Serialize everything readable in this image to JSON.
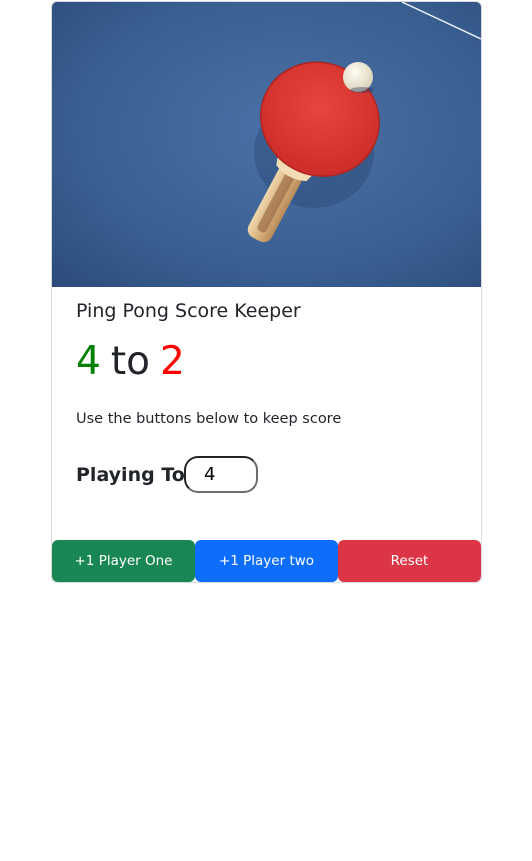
{
  "card": {
    "title": "Ping Pong Score Keeper",
    "score": {
      "player_one": "4",
      "separator": "to",
      "player_two": "2"
    },
    "description": "Use the buttons below to keep score",
    "playing_to": {
      "label": "Playing To",
      "value": "4"
    },
    "buttons": {
      "player_one": "+1 Player One",
      "player_two": "+1 Player two",
      "reset": "Reset"
    }
  },
  "colors": {
    "player_one_score": "#008000",
    "player_two_score": "#ff0000",
    "player_one_button": "#198754",
    "player_two_button": "#0d6efd",
    "reset_button": "#dc3545",
    "table_blue": "#3a5f92"
  },
  "icons": {
    "image": "ping-pong-paddle-image"
  }
}
